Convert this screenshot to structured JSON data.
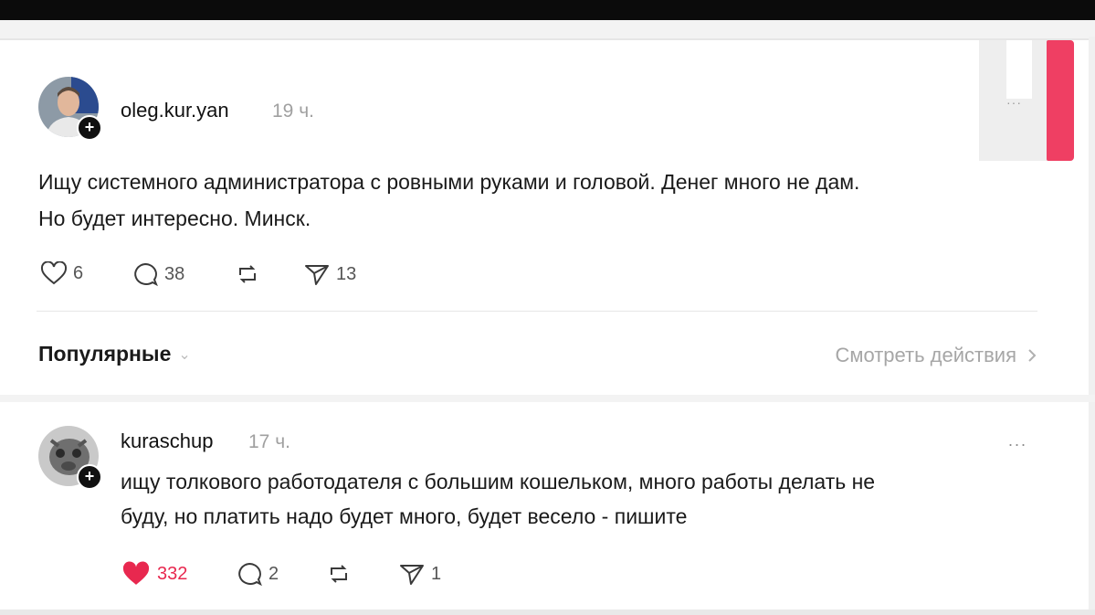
{
  "post": {
    "username": "oleg.kur.yan",
    "time": "19 ч.",
    "text_line1": "Ищу системного администратора с ровными руками и головой. Денег много не дам.",
    "text_line2": "Но будет интересно. Минск.",
    "likes": "6",
    "comments": "38",
    "shares": "13"
  },
  "filter": {
    "label": "Популярные",
    "view_activity": "Смотреть действия"
  },
  "reply": {
    "username": "kuraschup",
    "time": "17 ч.",
    "more": "...",
    "text_line1": "ищу толкового работодателя с большим кошельком, много работы делать не",
    "text_line2": "буду, но платить надо будет много, будет весело - пишите",
    "likes": "332",
    "comments": "2",
    "shares": "1"
  },
  "colors": {
    "like_active": "#e8284f",
    "logo_accent": "#ef3f63",
    "muted_text": "#a0a0a0"
  },
  "icons": [
    "heart-icon",
    "comment-icon",
    "repost-icon",
    "send-icon",
    "chevron-down-icon",
    "chevron-right-icon",
    "plus-icon"
  ]
}
